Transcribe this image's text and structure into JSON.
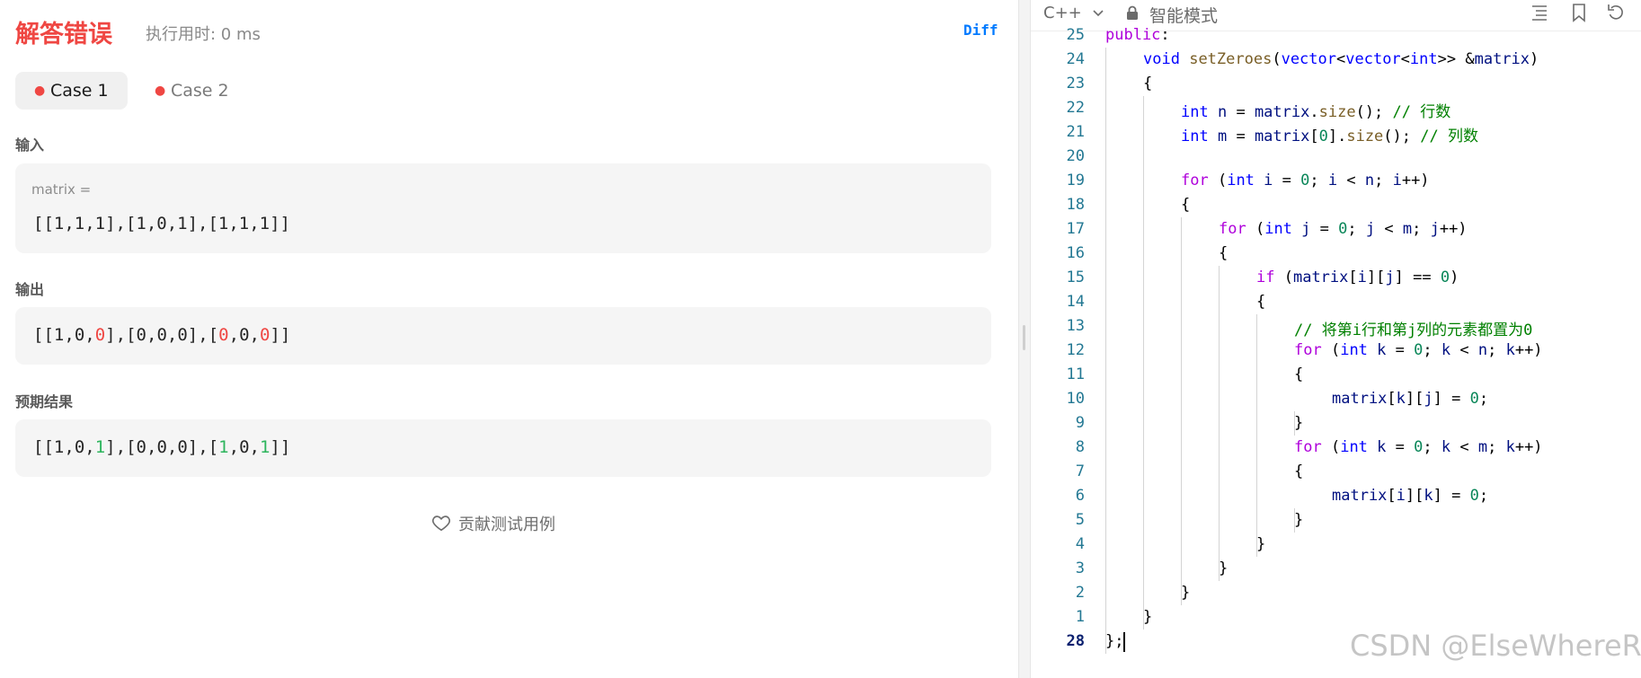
{
  "result": {
    "status": "解答错误",
    "runtime": "执行用时: 0 ms",
    "diff_label": "Diff"
  },
  "tabs": [
    {
      "label": "Case 1",
      "active": true
    },
    {
      "label": "Case 2",
      "active": false
    }
  ],
  "input": {
    "label": "输入",
    "var_name": "matrix =",
    "value": "[[1,1,1],[1,0,1],[1,1,1]]"
  },
  "output": {
    "label": "输出",
    "value": "[[1,0,0],[0,0,0],[0,0,0]]"
  },
  "expected": {
    "label": "预期结果",
    "value": "[[1,0,1],[0,0,0],[1,0,1]]"
  },
  "contribute_label": "贡献测试用例",
  "editor": {
    "language": "C++",
    "mode": "智能模式",
    "icons": [
      "format-icon",
      "bookmark-icon",
      "reset-icon"
    ],
    "line_numbers": [
      "25",
      "24",
      "23",
      "22",
      "21",
      "20",
      "19",
      "18",
      "17",
      "16",
      "15",
      "14",
      "13",
      "12",
      "11",
      "10",
      "9",
      "8",
      "7",
      "6",
      "5",
      "4",
      "3",
      "2",
      "1",
      "28"
    ],
    "current_line": "28"
  },
  "watermark": "CSDN @ElseWhereR",
  "colors": {
    "error": "#ef4743",
    "success": "#2db55d",
    "accent": "#007aff"
  }
}
